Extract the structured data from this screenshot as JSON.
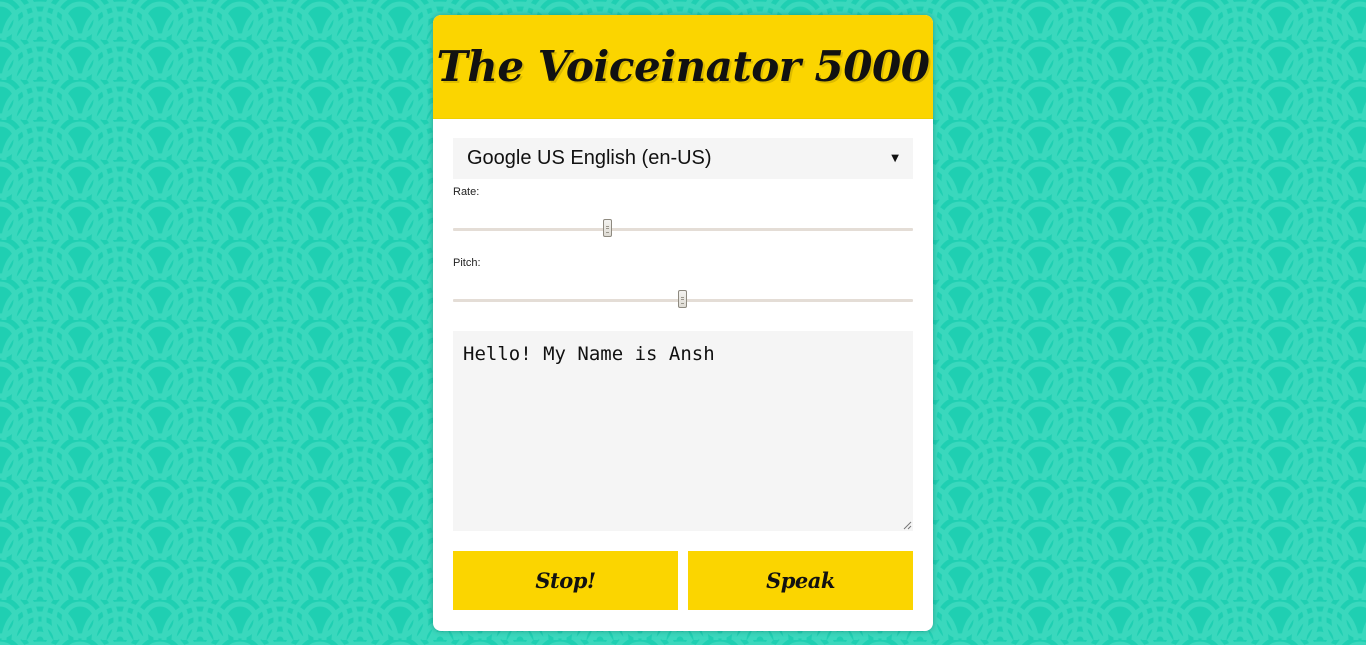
{
  "app": {
    "title": "The Voiceinator 5000"
  },
  "voice_select": {
    "selected": "Google US English (en-US)"
  },
  "rate": {
    "label": "Rate:",
    "min": 0,
    "max": 3,
    "value": 1
  },
  "pitch": {
    "label": "Pitch:",
    "min": 0,
    "max": 2,
    "value": 1
  },
  "message": {
    "value": "Hello! My Name is Ansh"
  },
  "buttons": {
    "stop_label": "Stop!",
    "speak_label": "Speak"
  },
  "colors": {
    "background": "#1fcfb2",
    "accent": "#fbd500",
    "panel": "#ffffff",
    "field": "#f5f5f5"
  },
  "icons": {
    "select_caret": "triangle-down",
    "textarea_grip": "resize-grip"
  }
}
